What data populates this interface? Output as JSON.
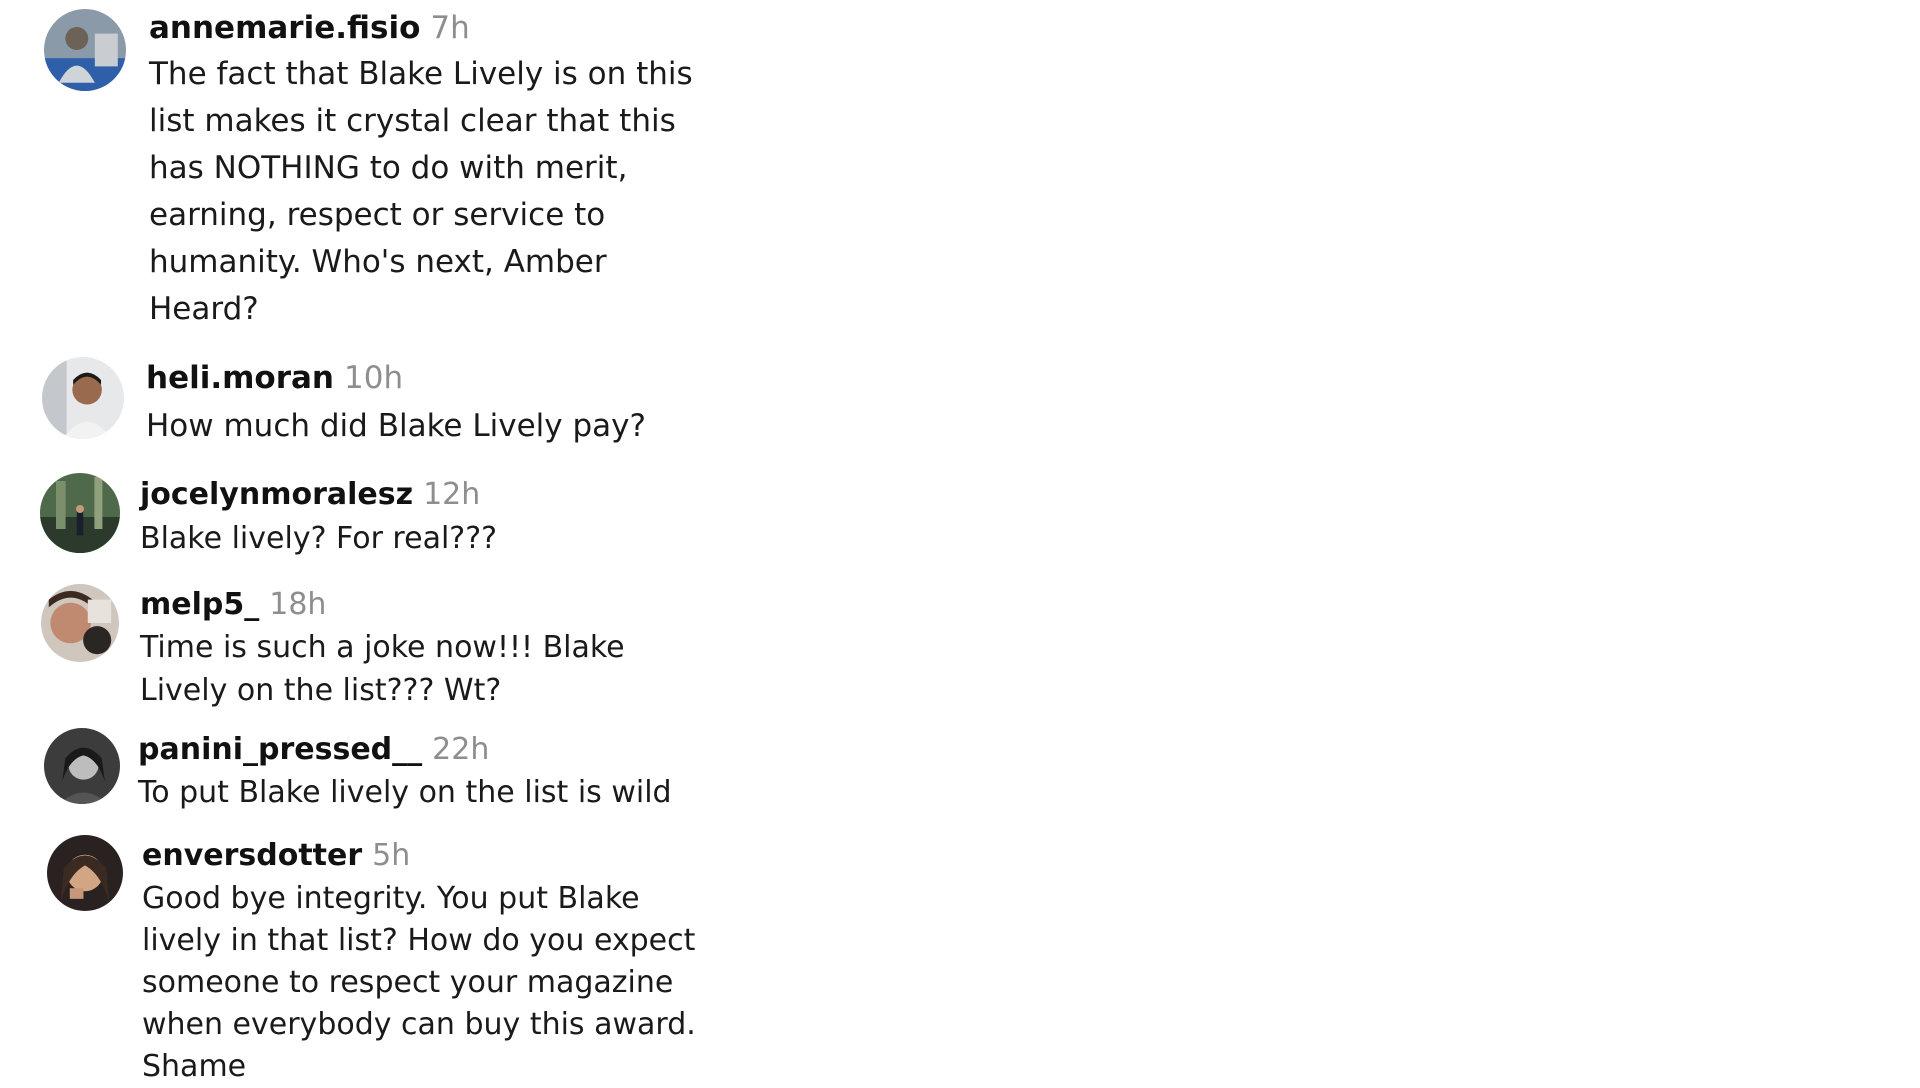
{
  "comments": [
    {
      "username": "annemarie.fisio",
      "time": "7h",
      "text": "The fact that Blake Lively is on this list makes it crystal clear that this has NOTHING to do with merit, earning, respect or service to humanity. Who's next, Amber Heard?",
      "avatar_icon": "user-avatar-photo"
    },
    {
      "username": "heli.moran",
      "time": "10h",
      "text": "How much did Blake Lively pay?",
      "avatar_icon": "user-avatar-photo"
    },
    {
      "username": "jocelynmoralesz",
      "time": "12h",
      "text": "Blake lively? For real???",
      "avatar_icon": "user-avatar-photo"
    },
    {
      "username": "melp5_",
      "time": "18h",
      "text": "Time is such a joke now!!! Blake Lively on the list??? Wt?",
      "avatar_icon": "user-avatar-photo"
    },
    {
      "username": "panini_pressed__",
      "time": "22h",
      "text": "To put Blake lively on the list is wild",
      "avatar_icon": "user-avatar-photo"
    },
    {
      "username": "enversdotter",
      "time": "5h",
      "text": "Good bye integrity. You put Blake lively in that list? How do you expect someone to respect your magazine when everybody can buy this award. Shame",
      "avatar_icon": "user-avatar-photo"
    }
  ],
  "colors": {
    "username": "#111111",
    "timestamp": "#8e8e8e",
    "body_text": "#1a1a1a",
    "background": "#ffffff"
  }
}
